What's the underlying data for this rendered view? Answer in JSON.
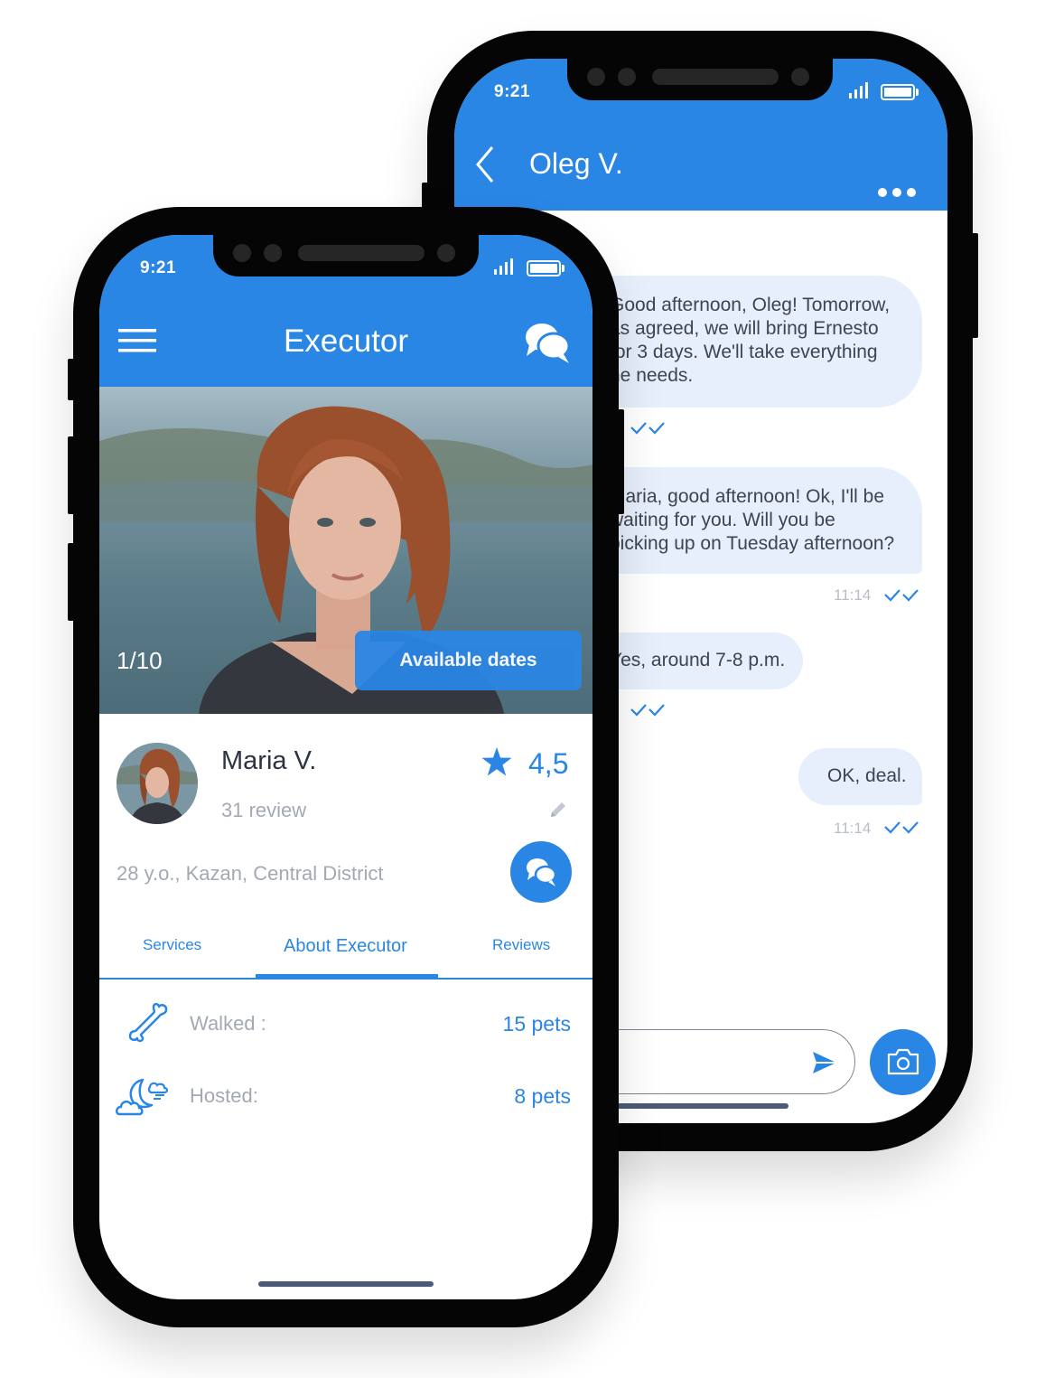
{
  "colors": {
    "accent": "#2a86e5",
    "bubble": "#e6effb",
    "phone": "#050505"
  },
  "status_bar": {
    "time": "9:21"
  },
  "chat_screen": {
    "contact_name": "Oleg V.",
    "messages": [
      {
        "lines": [
          "Good afternoon, Oleg! Tomorrow,",
          "as agreed, we will bring Ernesto",
          "for 3 days. We'll take everything",
          "he needs."
        ]
      },
      {
        "lines": [
          "Maria, good afternoon! Ok, I'll be",
          "waiting for you. Will you be",
          "picking up on Tuesday afternoon?"
        ],
        "time": "11:14"
      },
      {
        "lines": [
          "Yes, around  7-8 p.m."
        ]
      },
      {
        "lines": [
          "OK, deal."
        ],
        "time": "11:14"
      }
    ],
    "icons": {
      "back": "chevron-left-icon",
      "more": "more-dots-icon",
      "send": "send-icon",
      "camera": "camera-icon"
    }
  },
  "executor_screen": {
    "header_title": "Executor",
    "photo_counter": "1/10",
    "available_dates_label": "Available dates",
    "profile": {
      "name": "Maria V.",
      "rating": "4,5",
      "reviews": "31 review",
      "details": "28 y.o., Kazan, Central District"
    },
    "tabs": [
      {
        "label": "Services",
        "active": false
      },
      {
        "label": "About Executor",
        "active": true
      },
      {
        "label": "Reviews",
        "active": false
      }
    ],
    "stats": [
      {
        "label": "Walked :",
        "value": "15 pets",
        "icon": "bone-icon"
      },
      {
        "label": "Hosted:",
        "value": "8 pets",
        "icon": "moon-cloud-icon"
      }
    ],
    "icons": {
      "menu": "hamburger-menu-icon",
      "chat": "chat-bubbles-icon",
      "star": "star-icon",
      "edit": "pencil-icon"
    }
  }
}
